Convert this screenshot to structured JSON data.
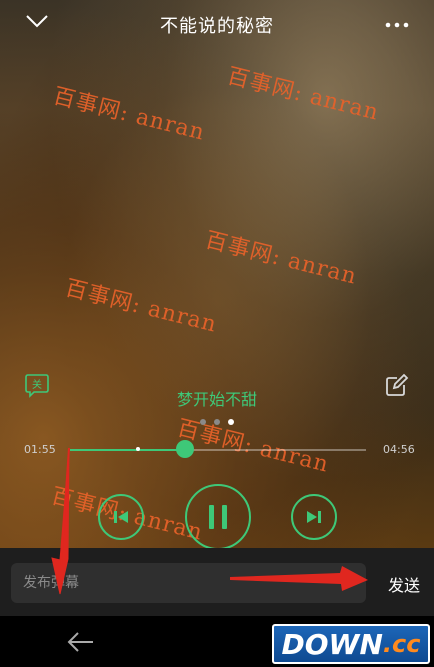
{
  "header": {
    "title": "不能说的秘密"
  },
  "watermarks": [
    "百事网: anran",
    "百事网: anran",
    "百事网: anran",
    "百事网: anran",
    "百事网: anran",
    "百事网: anran"
  ],
  "lyric": {
    "current_line": "梦开始不甜",
    "left_icon_label": "关"
  },
  "player": {
    "elapsed": "01:55",
    "duration": "04:56",
    "progress": 0.39,
    "buffered": 0.23,
    "lyrics_page_dots": 3,
    "lyrics_page_active": 2
  },
  "danmaku": {
    "placeholder": "发布弹幕",
    "send_label": "发送"
  },
  "logo": {
    "text": "DOWN",
    "suffix": ".cc"
  },
  "colors": {
    "accent": "#3ec878",
    "watermark": "#e8622a",
    "arrow": "#e0271f"
  }
}
